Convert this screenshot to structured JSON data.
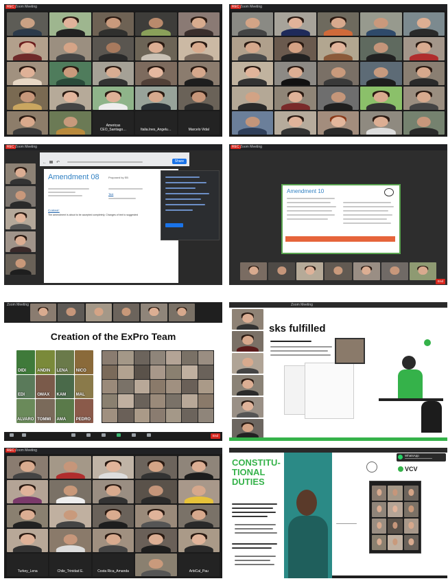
{
  "panels": {
    "p1": {
      "meeting_title": "Zoom Meeting",
      "rec": "REC",
      "tile_labels": [
        "Americas CEO_Santiago…",
        "Italia.Ines_Angelu…",
        "Marcelo Vidal"
      ]
    },
    "p2": {
      "meeting_title": "Zoom Meeting",
      "rec": "REC"
    },
    "p3": {
      "meeting_title": "Zoom Meeting",
      "rec": "REC",
      "doc_title": "Amendment 08",
      "share_button": "Share",
      "doc_field_1": "Proposed by EB",
      "doc_field_2": "Text",
      "doc_context": "Context:",
      "doc_body": "The amendment is about to be accepted completely. Changes of text to suggested"
    },
    "p4": {
      "meeting_title": "Zoom Meeting",
      "rec": "REC",
      "doc_title": "Amendment 10",
      "end_button": "End"
    },
    "p5": {
      "meeting_title": "Zoom Meeting",
      "slide_title": "Creation of the ExPro Team",
      "kid_labels": [
        "DIDI",
        "ANDIN",
        "LENA",
        "NICO",
        "EDI",
        "OMAX",
        "KAM",
        "MAL",
        "ALVARO",
        "TOMMI",
        "AMA",
        "PEDRO"
      ],
      "end_button": "End"
    },
    "p6": {
      "meeting_title": "Zoom Meeting",
      "slide_title": "sks fulfilled"
    },
    "p7": {
      "meeting_title": "Zoom Meeting",
      "rec": "REC",
      "tile_labels": [
        "Turkey_Lena",
        "Chile_Trinidad E.",
        "Costa Rica_Amanda",
        "ArbiCal_Pau"
      ]
    },
    "p8": {
      "slide_heading": "CONSTITU-TIONAL DUTIES",
      "brand": "VCV",
      "whatsapp_label": "WhatsApp"
    }
  },
  "colors": {
    "zoom_dark": "#1b1b1b",
    "rec_red": "#d7261e",
    "amend_blue": "#2e7fc2",
    "vcv_green": "#35b24a",
    "teal": "#2b8a86"
  }
}
